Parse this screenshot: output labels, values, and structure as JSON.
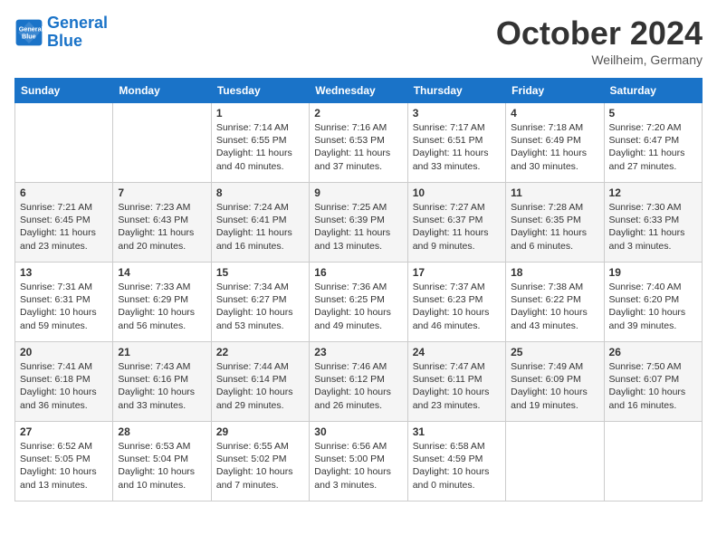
{
  "header": {
    "logo_line1": "General",
    "logo_line2": "Blue",
    "month": "October 2024",
    "location": "Weilheim, Germany"
  },
  "days_of_week": [
    "Sunday",
    "Monday",
    "Tuesday",
    "Wednesday",
    "Thursday",
    "Friday",
    "Saturday"
  ],
  "weeks": [
    [
      {
        "day": "",
        "sunrise": "",
        "sunset": "",
        "daylight": ""
      },
      {
        "day": "",
        "sunrise": "",
        "sunset": "",
        "daylight": ""
      },
      {
        "day": "1",
        "sunrise": "Sunrise: 7:14 AM",
        "sunset": "Sunset: 6:55 PM",
        "daylight": "Daylight: 11 hours and 40 minutes."
      },
      {
        "day": "2",
        "sunrise": "Sunrise: 7:16 AM",
        "sunset": "Sunset: 6:53 PM",
        "daylight": "Daylight: 11 hours and 37 minutes."
      },
      {
        "day": "3",
        "sunrise": "Sunrise: 7:17 AM",
        "sunset": "Sunset: 6:51 PM",
        "daylight": "Daylight: 11 hours and 33 minutes."
      },
      {
        "day": "4",
        "sunrise": "Sunrise: 7:18 AM",
        "sunset": "Sunset: 6:49 PM",
        "daylight": "Daylight: 11 hours and 30 minutes."
      },
      {
        "day": "5",
        "sunrise": "Sunrise: 7:20 AM",
        "sunset": "Sunset: 6:47 PM",
        "daylight": "Daylight: 11 hours and 27 minutes."
      }
    ],
    [
      {
        "day": "6",
        "sunrise": "Sunrise: 7:21 AM",
        "sunset": "Sunset: 6:45 PM",
        "daylight": "Daylight: 11 hours and 23 minutes."
      },
      {
        "day": "7",
        "sunrise": "Sunrise: 7:23 AM",
        "sunset": "Sunset: 6:43 PM",
        "daylight": "Daylight: 11 hours and 20 minutes."
      },
      {
        "day": "8",
        "sunrise": "Sunrise: 7:24 AM",
        "sunset": "Sunset: 6:41 PM",
        "daylight": "Daylight: 11 hours and 16 minutes."
      },
      {
        "day": "9",
        "sunrise": "Sunrise: 7:25 AM",
        "sunset": "Sunset: 6:39 PM",
        "daylight": "Daylight: 11 hours and 13 minutes."
      },
      {
        "day": "10",
        "sunrise": "Sunrise: 7:27 AM",
        "sunset": "Sunset: 6:37 PM",
        "daylight": "Daylight: 11 hours and 9 minutes."
      },
      {
        "day": "11",
        "sunrise": "Sunrise: 7:28 AM",
        "sunset": "Sunset: 6:35 PM",
        "daylight": "Daylight: 11 hours and 6 minutes."
      },
      {
        "day": "12",
        "sunrise": "Sunrise: 7:30 AM",
        "sunset": "Sunset: 6:33 PM",
        "daylight": "Daylight: 11 hours and 3 minutes."
      }
    ],
    [
      {
        "day": "13",
        "sunrise": "Sunrise: 7:31 AM",
        "sunset": "Sunset: 6:31 PM",
        "daylight": "Daylight: 10 hours and 59 minutes."
      },
      {
        "day": "14",
        "sunrise": "Sunrise: 7:33 AM",
        "sunset": "Sunset: 6:29 PM",
        "daylight": "Daylight: 10 hours and 56 minutes."
      },
      {
        "day": "15",
        "sunrise": "Sunrise: 7:34 AM",
        "sunset": "Sunset: 6:27 PM",
        "daylight": "Daylight: 10 hours and 53 minutes."
      },
      {
        "day": "16",
        "sunrise": "Sunrise: 7:36 AM",
        "sunset": "Sunset: 6:25 PM",
        "daylight": "Daylight: 10 hours and 49 minutes."
      },
      {
        "day": "17",
        "sunrise": "Sunrise: 7:37 AM",
        "sunset": "Sunset: 6:23 PM",
        "daylight": "Daylight: 10 hours and 46 minutes."
      },
      {
        "day": "18",
        "sunrise": "Sunrise: 7:38 AM",
        "sunset": "Sunset: 6:22 PM",
        "daylight": "Daylight: 10 hours and 43 minutes."
      },
      {
        "day": "19",
        "sunrise": "Sunrise: 7:40 AM",
        "sunset": "Sunset: 6:20 PM",
        "daylight": "Daylight: 10 hours and 39 minutes."
      }
    ],
    [
      {
        "day": "20",
        "sunrise": "Sunrise: 7:41 AM",
        "sunset": "Sunset: 6:18 PM",
        "daylight": "Daylight: 10 hours and 36 minutes."
      },
      {
        "day": "21",
        "sunrise": "Sunrise: 7:43 AM",
        "sunset": "Sunset: 6:16 PM",
        "daylight": "Daylight: 10 hours and 33 minutes."
      },
      {
        "day": "22",
        "sunrise": "Sunrise: 7:44 AM",
        "sunset": "Sunset: 6:14 PM",
        "daylight": "Daylight: 10 hours and 29 minutes."
      },
      {
        "day": "23",
        "sunrise": "Sunrise: 7:46 AM",
        "sunset": "Sunset: 6:12 PM",
        "daylight": "Daylight: 10 hours and 26 minutes."
      },
      {
        "day": "24",
        "sunrise": "Sunrise: 7:47 AM",
        "sunset": "Sunset: 6:11 PM",
        "daylight": "Daylight: 10 hours and 23 minutes."
      },
      {
        "day": "25",
        "sunrise": "Sunrise: 7:49 AM",
        "sunset": "Sunset: 6:09 PM",
        "daylight": "Daylight: 10 hours and 19 minutes."
      },
      {
        "day": "26",
        "sunrise": "Sunrise: 7:50 AM",
        "sunset": "Sunset: 6:07 PM",
        "daylight": "Daylight: 10 hours and 16 minutes."
      }
    ],
    [
      {
        "day": "27",
        "sunrise": "Sunrise: 6:52 AM",
        "sunset": "Sunset: 5:05 PM",
        "daylight": "Daylight: 10 hours and 13 minutes."
      },
      {
        "day": "28",
        "sunrise": "Sunrise: 6:53 AM",
        "sunset": "Sunset: 5:04 PM",
        "daylight": "Daylight: 10 hours and 10 minutes."
      },
      {
        "day": "29",
        "sunrise": "Sunrise: 6:55 AM",
        "sunset": "Sunset: 5:02 PM",
        "daylight": "Daylight: 10 hours and 7 minutes."
      },
      {
        "day": "30",
        "sunrise": "Sunrise: 6:56 AM",
        "sunset": "Sunset: 5:00 PM",
        "daylight": "Daylight: 10 hours and 3 minutes."
      },
      {
        "day": "31",
        "sunrise": "Sunrise: 6:58 AM",
        "sunset": "Sunset: 4:59 PM",
        "daylight": "Daylight: 10 hours and 0 minutes."
      },
      {
        "day": "",
        "sunrise": "",
        "sunset": "",
        "daylight": ""
      },
      {
        "day": "",
        "sunrise": "",
        "sunset": "",
        "daylight": ""
      }
    ]
  ]
}
